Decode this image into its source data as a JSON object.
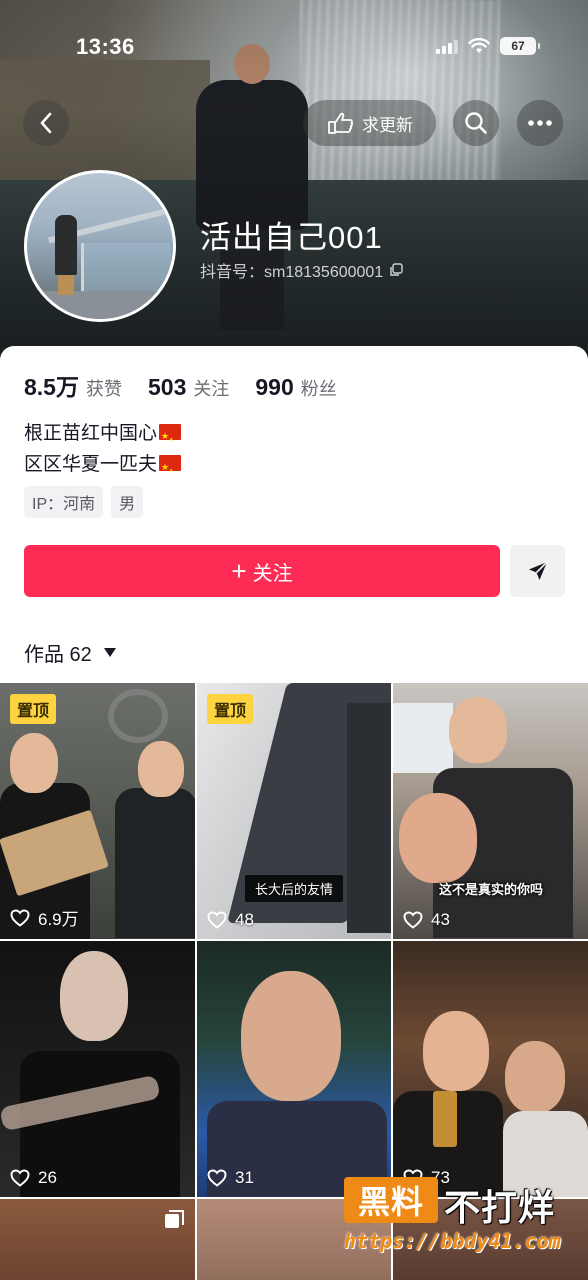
{
  "status_bar": {
    "time": "13:36",
    "battery": "67"
  },
  "header": {
    "request_update_label": "求更新",
    "username": "活出自己001",
    "douyin_id": "抖音号：sm18135600001"
  },
  "stats": [
    {
      "value": "8.5万",
      "label": "获赞"
    },
    {
      "value": "503",
      "label": "关注"
    },
    {
      "value": "990",
      "label": "粉丝"
    }
  ],
  "bio": {
    "line1": "根正苗红中国心",
    "line2": "区区华夏一匹夫"
  },
  "tags": [
    "IP：河南",
    "男"
  ],
  "actions": {
    "follow_label": "关注"
  },
  "works_tab": {
    "label": "作品 62"
  },
  "videos": [
    {
      "pinned_label": "置顶",
      "likes": "6.9万"
    },
    {
      "pinned_label": "置顶",
      "likes": "48",
      "caption": "长大后的友情"
    },
    {
      "likes": "43",
      "caption": "这不是真实的你吗"
    },
    {
      "likes": "26"
    },
    {
      "likes": "31"
    },
    {
      "likes": "73"
    }
  ],
  "watermark": {
    "badge": "黑料",
    "text": "不打烊",
    "url": "https://bbdy41.com"
  },
  "colors": {
    "accent": "#fe2c55",
    "pin": "#fdd440",
    "watermark": "#f08a16"
  }
}
